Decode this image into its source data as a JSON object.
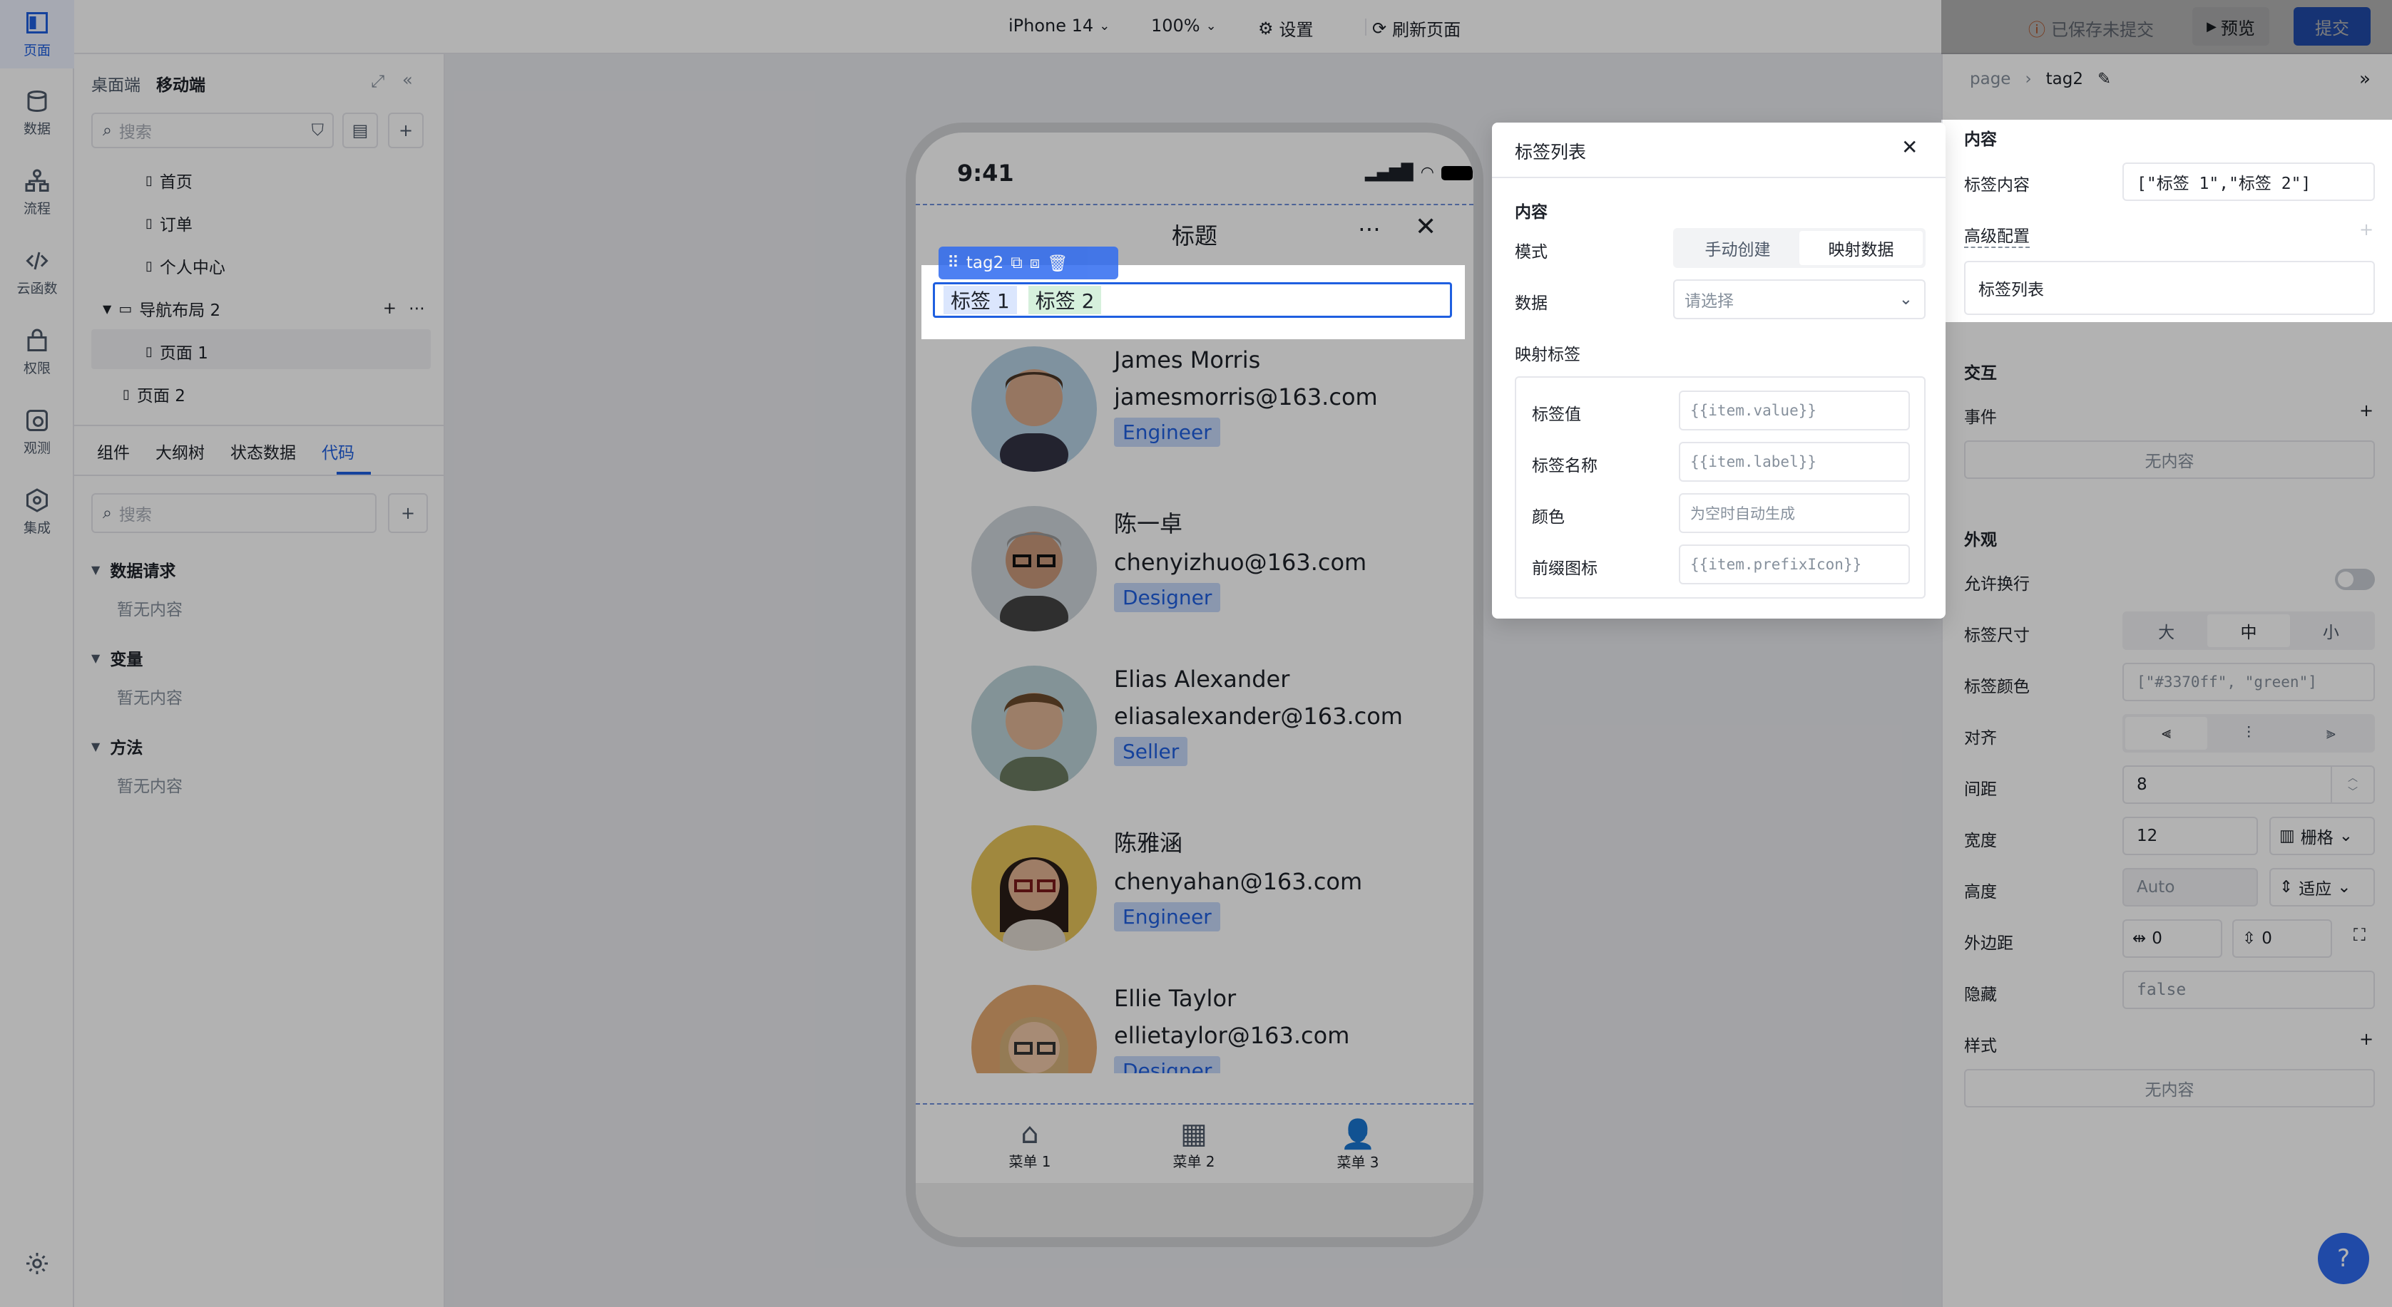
{
  "rail": {
    "items": [
      {
        "label": "页面",
        "icon": "page-icon"
      },
      {
        "label": "数据",
        "icon": "database-icon"
      },
      {
        "label": "流程",
        "icon": "flow-icon"
      },
      {
        "label": "云函数",
        "icon": "code-icon"
      },
      {
        "label": "权限",
        "icon": "lock-icon"
      },
      {
        "label": "观测",
        "icon": "monitor-icon"
      },
      {
        "label": "集成",
        "icon": "integration-icon"
      }
    ]
  },
  "topbar": {
    "device": "iPhone 14",
    "zoom": "100%",
    "settings": "设置",
    "refresh": "刷新页面",
    "status": "已保存未提交",
    "preview": "预览",
    "submit": "提交"
  },
  "leftpanel": {
    "tabs_top": [
      "桌面端",
      "移动端"
    ],
    "search_placeholder": "搜索",
    "tree": [
      {
        "label": "首页",
        "level": 2
      },
      {
        "label": "订单",
        "level": 2
      },
      {
        "label": "个人中心",
        "level": 2
      },
      {
        "label": "导航布局 2",
        "level": 1
      },
      {
        "label": "页面 1",
        "level": 2
      },
      {
        "label": "页面 2",
        "level": 1
      }
    ],
    "tabs_bottom": [
      "组件",
      "大纲树",
      "状态数据",
      "代码"
    ],
    "search2_placeholder": "搜索",
    "sections": [
      {
        "title": "数据请求",
        "empty": "暂无内容"
      },
      {
        "title": "变量",
        "empty": "暂无内容"
      },
      {
        "title": "方法",
        "empty": "暂无内容"
      }
    ]
  },
  "phone": {
    "time": "9:41",
    "title": "标题",
    "component_label": "tag2",
    "tags": [
      "标签 1",
      "标签 2"
    ],
    "people": [
      {
        "name": "James Morris",
        "email": "jamesmorris@163.com",
        "role": "Engineer"
      },
      {
        "name": "陈一卓",
        "email": "chenyizhuo@163.com",
        "role": "Designer"
      },
      {
        "name": "Elias Alexander",
        "email": "eliasalexander@163.com",
        "role": "Seller"
      },
      {
        "name": "陈雅涵",
        "email": "chenyahan@163.com",
        "role": "Engineer"
      },
      {
        "name": "Ellie Taylor",
        "email": "ellietaylor@163.com",
        "role": "Designer"
      }
    ],
    "tabbar": [
      "菜单 1",
      "菜单 2",
      "菜单 3"
    ]
  },
  "modal": {
    "title": "标签列表",
    "section": "内容",
    "mode_label": "模式",
    "mode_options": [
      "手动创建",
      "映射数据"
    ],
    "data_label": "数据",
    "data_placeholder": "请选择",
    "map_label": "映射标签",
    "fields": [
      {
        "label": "标签值",
        "value": "{{item.value}}"
      },
      {
        "label": "标签名称",
        "value": "{{item.label}}"
      },
      {
        "label": "颜色",
        "value": "为空时自动生成"
      },
      {
        "label": "前缀图标",
        "value": "{{item.prefixIcon}}"
      }
    ]
  },
  "rightpanel": {
    "breadcrumb_root": "page",
    "breadcrumb_current": "tag2",
    "content_h": "内容",
    "tag_content_label": "标签内容",
    "tag_content_value": "[\"标签 1\",\"标签 2\"]",
    "advanced_label": "高级配置",
    "advanced_value": "标签列表",
    "interact_h": "交互",
    "event_label": "事件",
    "event_empty": "无内容",
    "appearance_h": "外观",
    "wrap_label": "允许换行",
    "size_label": "标签尺寸",
    "size_options": [
      "大",
      "中",
      "小"
    ],
    "color_label": "标签颜色",
    "color_value": "[\"#3370ff\", \"green\"]",
    "align_label": "对齐",
    "gap_label": "间距",
    "gap_value": "8",
    "width_label": "宽度",
    "width_value": "12",
    "width_unit": "栅格",
    "height_label": "高度",
    "height_value": "Auto",
    "height_unit": "适应",
    "margin_label": "外边距",
    "margin_h": "0",
    "margin_v": "0",
    "hidden_label": "隐藏",
    "hidden_value": "false",
    "style_label": "样式",
    "style_empty": "无内容"
  },
  "colors": {
    "accent": "#1f5fe0",
    "submit": "#2f6bf0",
    "tag2_bg": "#d6f0dc"
  }
}
